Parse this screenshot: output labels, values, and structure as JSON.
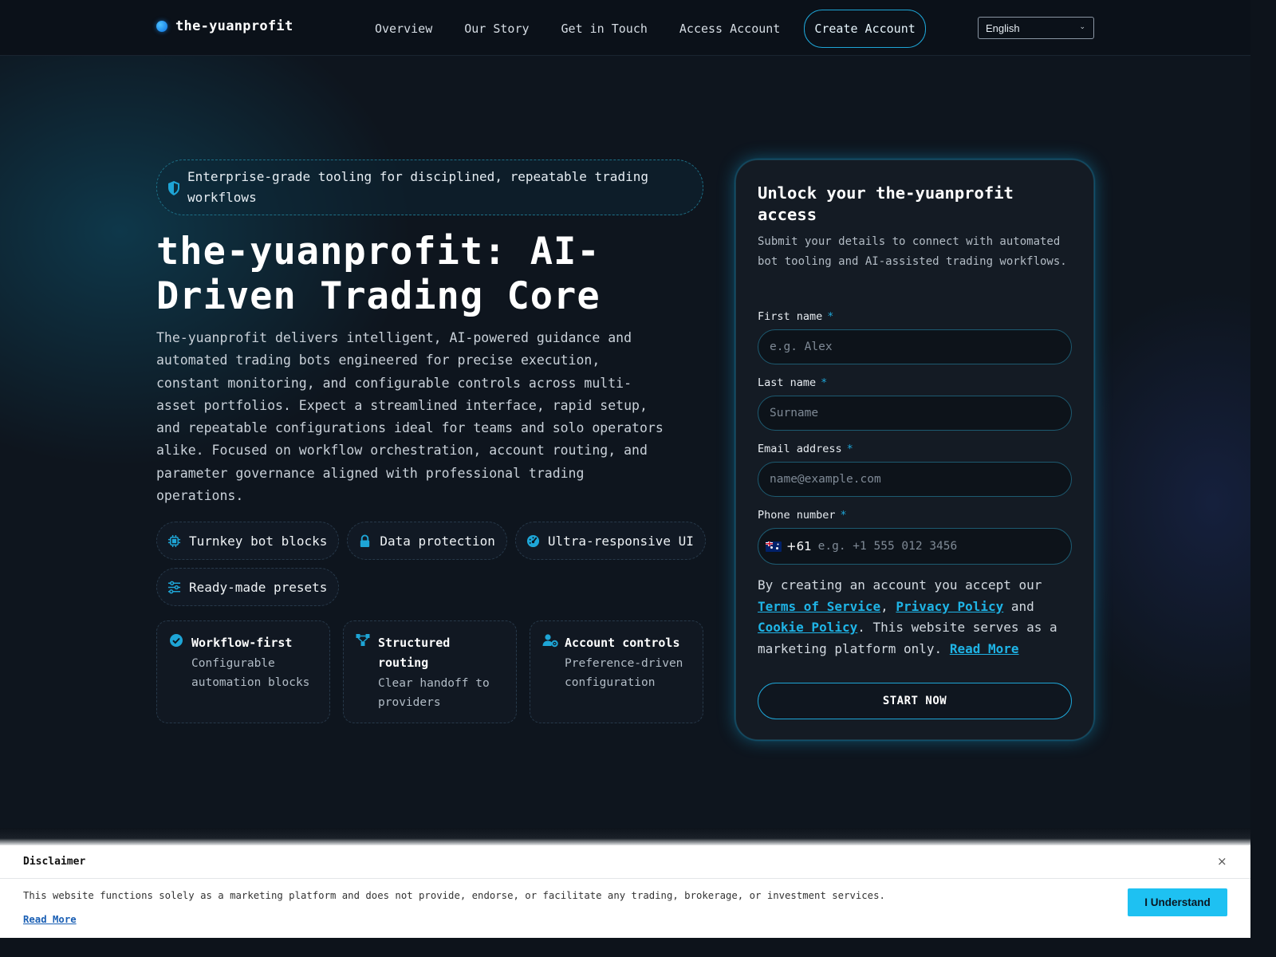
{
  "header": {
    "brand": "the-yuanprofit",
    "nav": [
      "Overview",
      "Our Story",
      "Get in Touch",
      "Access Account"
    ],
    "cta": "Create Account",
    "language": "English"
  },
  "hero": {
    "badge": "Enterprise-grade tooling for disciplined, repeatable trading workflows",
    "title": "the-yuanprofit: AI-Driven Trading Core",
    "lead": "The-yuanprofit delivers intelligent, AI-powered guidance and automated trading bots engineered for precise execution, constant monitoring, and configurable controls across multi-asset portfolios. Expect a streamlined interface, rapid setup, and repeatable configurations ideal for teams and solo operators alike. Focused on workflow orchestration, account routing, and parameter governance aligned with professional trading operations.",
    "chips": [
      {
        "label": "Turnkey bot blocks",
        "icon": "chip-icon"
      },
      {
        "label": "Data protection",
        "icon": "lock-icon"
      },
      {
        "label": "Ultra-responsive UI",
        "icon": "gauge-icon"
      },
      {
        "label": "Ready-made presets",
        "icon": "sliders-icon"
      }
    ],
    "cards": [
      {
        "title": "Workflow-first",
        "desc": "Configurable automation blocks",
        "icon": "check-circle-icon"
      },
      {
        "title": "Structured routing",
        "desc": "Clear handoff to providers",
        "icon": "diagram-icon"
      },
      {
        "title": "Account controls",
        "desc": "Preference-driven configuration",
        "icon": "user-gear-icon"
      }
    ]
  },
  "form": {
    "title": "Unlock your the-yuanprofit access",
    "subtitle": "Submit your details to connect with automated bot tooling and AI-assisted trading workflows.",
    "first_name": {
      "label": "First name",
      "required": "*",
      "placeholder": "e.g. Alex"
    },
    "last_name": {
      "label": "Last name",
      "required": "*",
      "placeholder": "Surname"
    },
    "email": {
      "label": "Email address",
      "required": "*",
      "placeholder": "name@example.com"
    },
    "phone": {
      "label": "Phone number",
      "required": "*",
      "dial_code": "+61",
      "placeholder": "e.g. +1 555 012 3456"
    },
    "legal": {
      "prefix": "By creating an account you accept our",
      "terms": "Terms of Service",
      "comma": ",",
      "privacy": "Privacy Policy",
      "and": "and",
      "cookie": "Cookie Policy",
      "suffix": ". This website serves as a marketing platform only.",
      "read_more": "Read More"
    },
    "submit": "START NOW"
  },
  "disclaimer": {
    "title": "Disclaimer",
    "close": "×",
    "text": "This website functions solely as a marketing platform and does not provide, endorse, or facilitate any trading, brokerage, or investment services.",
    "read_more": "Read More",
    "button": "I Understand"
  },
  "colors": {
    "accent": "#1ea5d6",
    "background": "#0d131b",
    "panel": "#141b24"
  }
}
